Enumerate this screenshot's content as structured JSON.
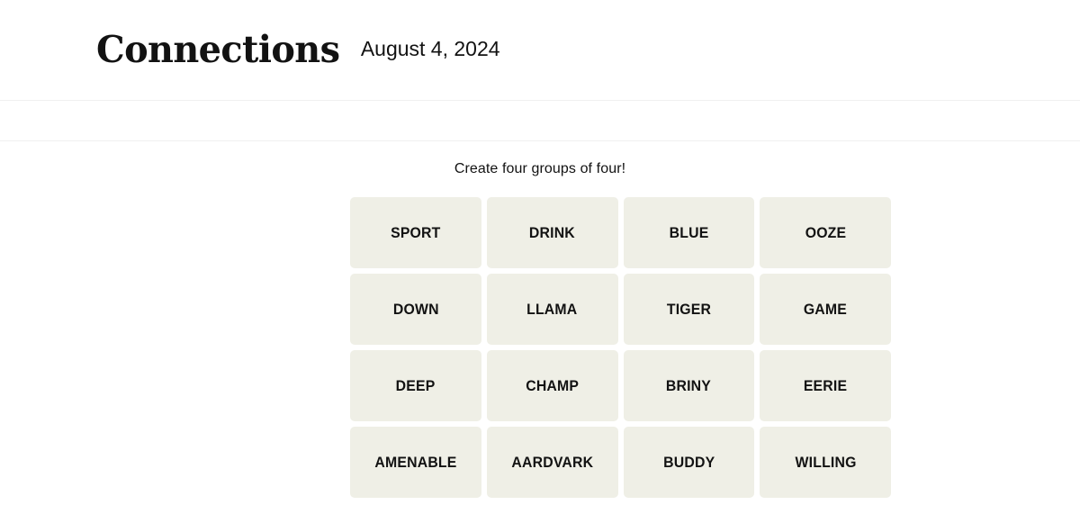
{
  "header": {
    "title": "Connections",
    "date": "August 4, 2024"
  },
  "board": {
    "instruction": "Create four groups of four!",
    "tiles": [
      "SPORT",
      "DRINK",
      "BLUE",
      "OOZE",
      "DOWN",
      "LLAMA",
      "TIGER",
      "GAME",
      "DEEP",
      "CHAMP",
      "BRINY",
      "EERIE",
      "AMENABLE",
      "AARDVARK",
      "BUDDY",
      "WILLING"
    ]
  },
  "colors": {
    "page_background": "#ffffff",
    "tile_background": "#efefe6",
    "text": "#121212",
    "divider": "#f0f0f0"
  }
}
